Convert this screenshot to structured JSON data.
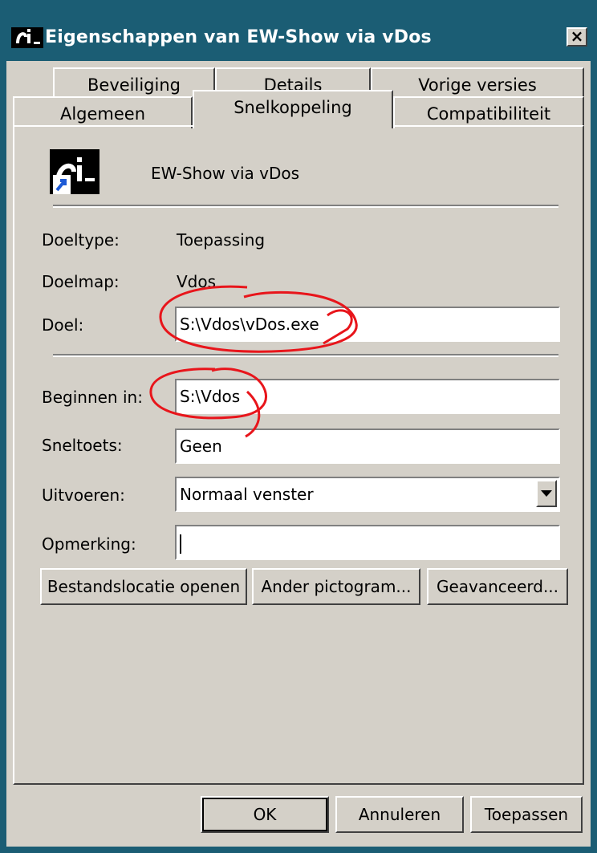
{
  "window": {
    "title": "Eigenschappen van EW-Show via vDos",
    "close_label": "×"
  },
  "tabs": {
    "row1": [
      {
        "label": "Beveiliging"
      },
      {
        "label": "Details"
      },
      {
        "label": "Vorige versies"
      }
    ],
    "row2": [
      {
        "label": "Algemeen"
      },
      {
        "label": "Snelkoppeling",
        "selected": true
      },
      {
        "label": "Compatibiliteit"
      }
    ]
  },
  "shortcut": {
    "name": "EW-Show via vDos",
    "icon": "shortcut-icon"
  },
  "fields": {
    "doeltype_label": "Doeltype:",
    "doeltype_value": "Toepassing",
    "doelmap_label": "Doelmap:",
    "doelmap_value": "Vdos",
    "doel_label": "Doel:",
    "doel_value": "S:\\Vdos\\vDos.exe",
    "beginnen_label": "Beginnen in:",
    "beginnen_value": "S:\\Vdos",
    "sneltoets_label": "Sneltoets:",
    "sneltoets_value": "Geen",
    "uitvoeren_label": "Uitvoeren:",
    "uitvoeren_value": "Normaal venster",
    "opmerking_label": "Opmerking:",
    "opmerking_value": ""
  },
  "buttons": {
    "open_location": "Bestandslocatie openen",
    "change_icon": "Ander pictogram...",
    "advanced": "Geavanceerd...",
    "ok": "OK",
    "cancel": "Annuleren",
    "apply": "Toepassen"
  },
  "colors": {
    "titlebar": "#1b5d74",
    "face": "#d4d0c8",
    "annotation": "#e8151b"
  }
}
